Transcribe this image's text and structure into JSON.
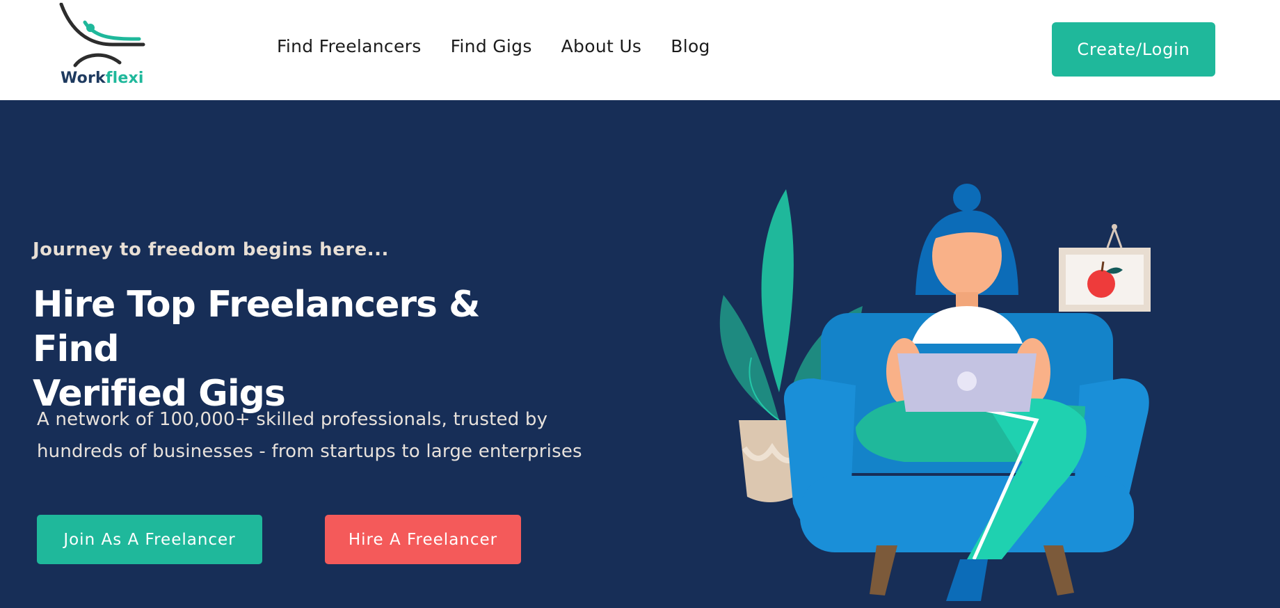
{
  "header": {
    "logo": {
      "text_primary": "Work",
      "text_accent": "flexi"
    },
    "nav": [
      {
        "label": "Find Freelancers"
      },
      {
        "label": "Find Gigs"
      },
      {
        "label": "About Us"
      },
      {
        "label": "Blog"
      }
    ],
    "cta_label": "Create/Login"
  },
  "hero": {
    "tagline": "Journey to freedom begins here...",
    "headline_line1": "Hire Top Freelancers & Find",
    "headline_line2": "Verified Gigs",
    "subtext_line1": "A network of 100,000+ skilled professionals, trusted by",
    "subtext_line2": "hundreds of businesses - from startups to large enterprises",
    "primary_button": "Join As A Freelancer",
    "secondary_button": "Hire A Freelancer"
  },
  "colors": {
    "brand_teal": "#1fb89b",
    "brand_navy": "#172e57",
    "accent_red": "#f45a5a"
  },
  "icons": {
    "logo": "workflexi-logo-icon",
    "illustration": "woman-on-couch-with-laptop-illustration"
  }
}
